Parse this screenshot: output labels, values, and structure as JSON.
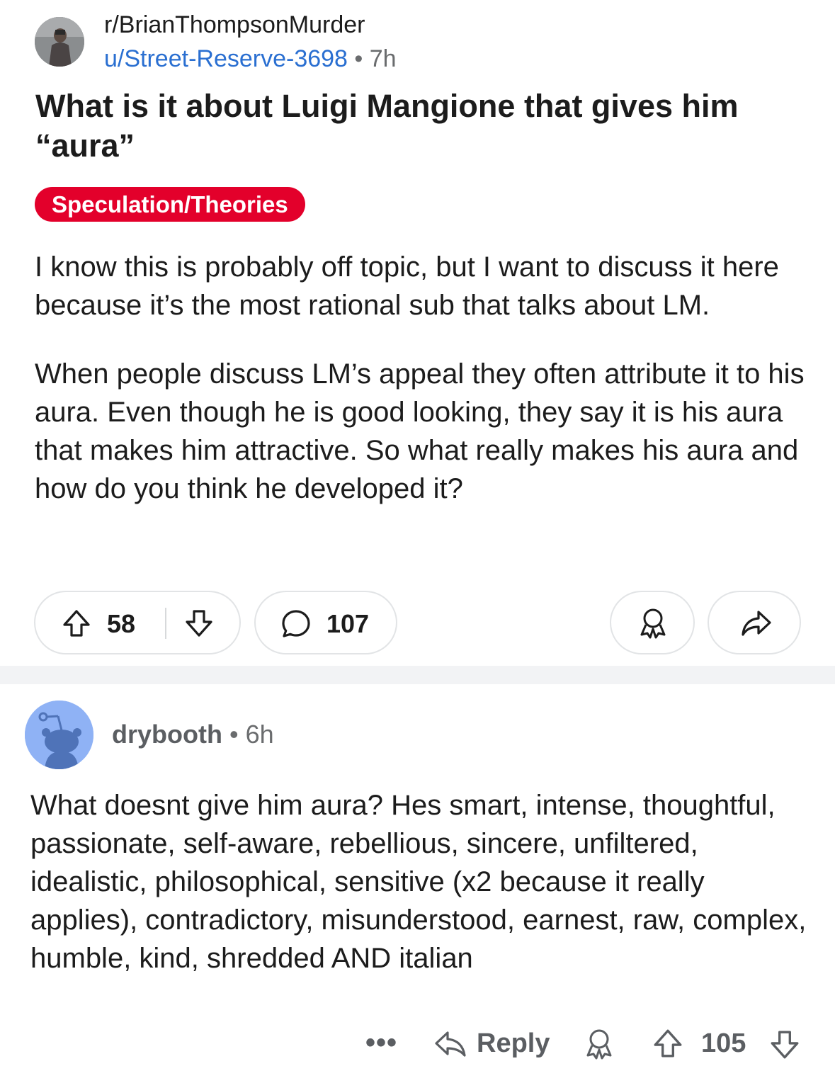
{
  "post": {
    "subreddit": "r/BrianThompsonMurder",
    "author": "u/Street-Reserve-3698",
    "separator": "•",
    "time": "7h",
    "title": "What is it about Luigi Mangione that gives him “aura”",
    "flair": "Speculation/Theories",
    "flair_color": "#e3002b",
    "body": [
      "I know this is probably off topic, but I want to discuss it here because it’s the most rational sub that talks about LM.",
      "When people discuss LM’s appeal they often attribute it to his aura. Even though he is good looking, they say it is his aura that makes him attractive. So what really makes his aura and how do you think he developed it?"
    ],
    "votes": "58",
    "comments": "107",
    "icons": {
      "upvote": "upvote-icon",
      "downvote": "downvote-icon",
      "comment": "comment-bubble-icon",
      "award": "award-icon",
      "share": "share-icon"
    }
  },
  "comment": {
    "author": "drybooth",
    "separator": "•",
    "time": "6h",
    "body": "What doesnt give him aura? Hes smart, intense, thoughtful, passionate, self-aware, rebellious, sincere, unfiltered, idealistic, philosophical, sensitive (x2 because it really applies), contradictory, misunderstood, earnest, raw, complex, humble, kind, shredded AND italian",
    "more": "•••",
    "reply_label": "Reply",
    "votes": "105",
    "avatar_color": "#8fb2f5"
  },
  "colors": {
    "link_blue": "#2a6fd1",
    "meta_gray": "#6a6c6e",
    "divider": "#f2f3f5"
  }
}
